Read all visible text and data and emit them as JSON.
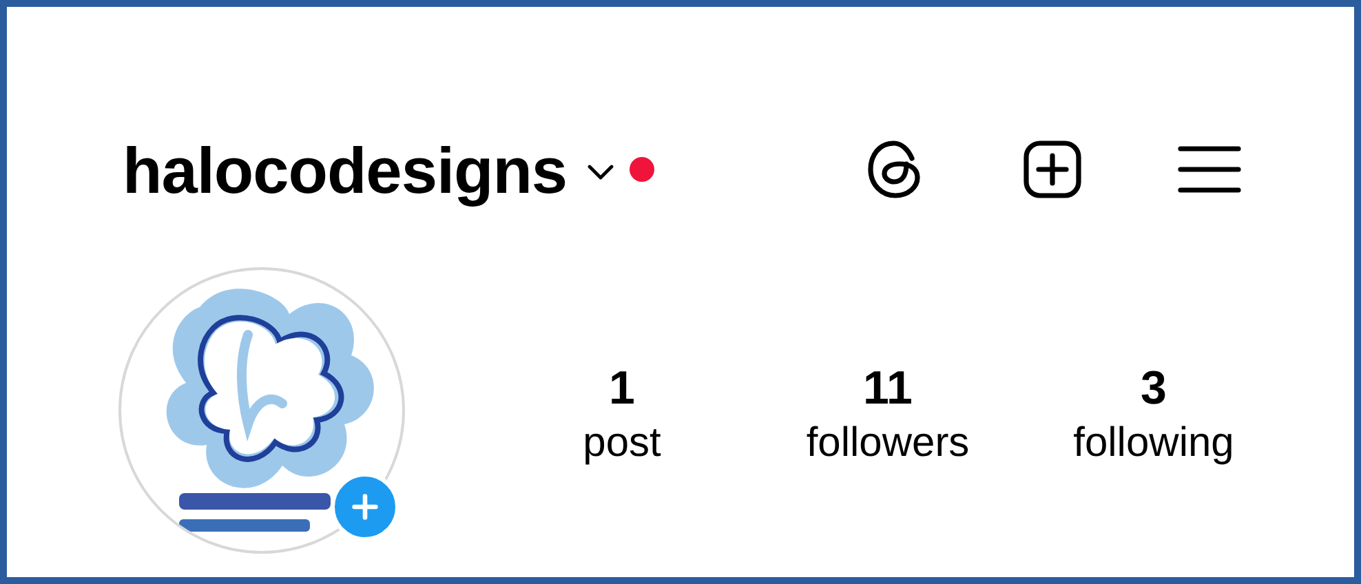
{
  "header": {
    "username": "halocodesigns",
    "has_notification": true
  },
  "stats": [
    {
      "count": "1",
      "label": "post"
    },
    {
      "count": "11",
      "label": "followers"
    },
    {
      "count": "3",
      "label": "following"
    }
  ]
}
